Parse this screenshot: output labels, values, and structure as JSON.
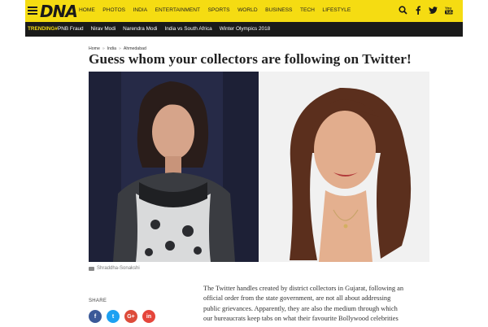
{
  "header": {
    "logo": "DNA",
    "nav": [
      "HOME",
      "PHOTOS",
      "INDIA",
      "ENTERTAINMENT",
      "SPORTS",
      "WORLD",
      "BUSINESS",
      "TECH",
      "LIFESTYLE"
    ],
    "icons": [
      "search-icon",
      "facebook-icon",
      "twitter-icon",
      "youtube-icon"
    ],
    "accent": "#f5dc12"
  },
  "trending": {
    "label": "TRENDING#",
    "items": [
      "PNB Fraud",
      "Nirav Modi",
      "Narendra Modi",
      "India vs South Africa",
      "Winter Olympics 2018"
    ]
  },
  "breadcrumb": [
    "Home",
    "India",
    "Ahmedabad"
  ],
  "article": {
    "title": "Guess whom your collectors are following on Twitter!",
    "image_caption": "Shraddha-Sonakshi",
    "share_label": "SHARE",
    "share_buttons": [
      {
        "name": "facebook",
        "glyph": "f",
        "color": "#3b5998"
      },
      {
        "name": "twitter",
        "glyph": "t",
        "color": "#1da1f2"
      },
      {
        "name": "google-plus",
        "glyph": "G+",
        "color": "#dd4b39"
      },
      {
        "name": "linkedin",
        "glyph": "in",
        "color": "#e5453b"
      }
    ],
    "body_lines": [
      "The Twitter handles created by district collectors in Gujarat, following an",
      "official order from the state government, are not all about addressing",
      "public grievances. Apparently, they are also the medium through which",
      "our bureaucrats keep tabs on what their favourite Bollywood celebrities"
    ]
  }
}
